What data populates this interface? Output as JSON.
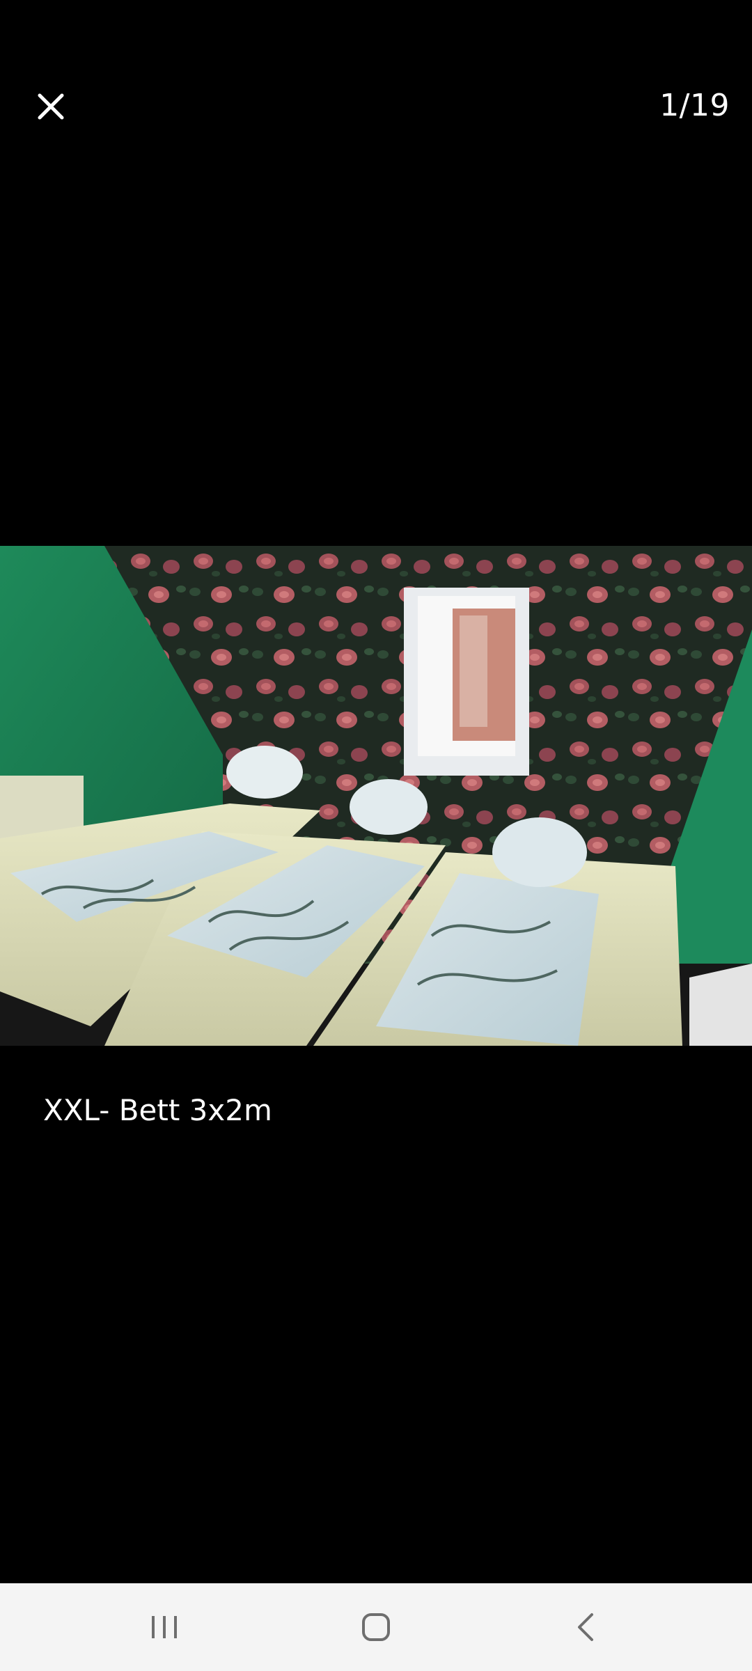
{
  "viewer": {
    "counter": "1/19",
    "caption": "XXL- Bett 3x2m"
  },
  "icons": {
    "close": "close-icon",
    "recents": "recent-apps-icon",
    "home": "home-icon",
    "back": "back-icon"
  },
  "colors": {
    "background": "#000000",
    "text": "#ffffff",
    "navbar": "#f4f4f4",
    "nav_icon": "#6e6e6e"
  }
}
